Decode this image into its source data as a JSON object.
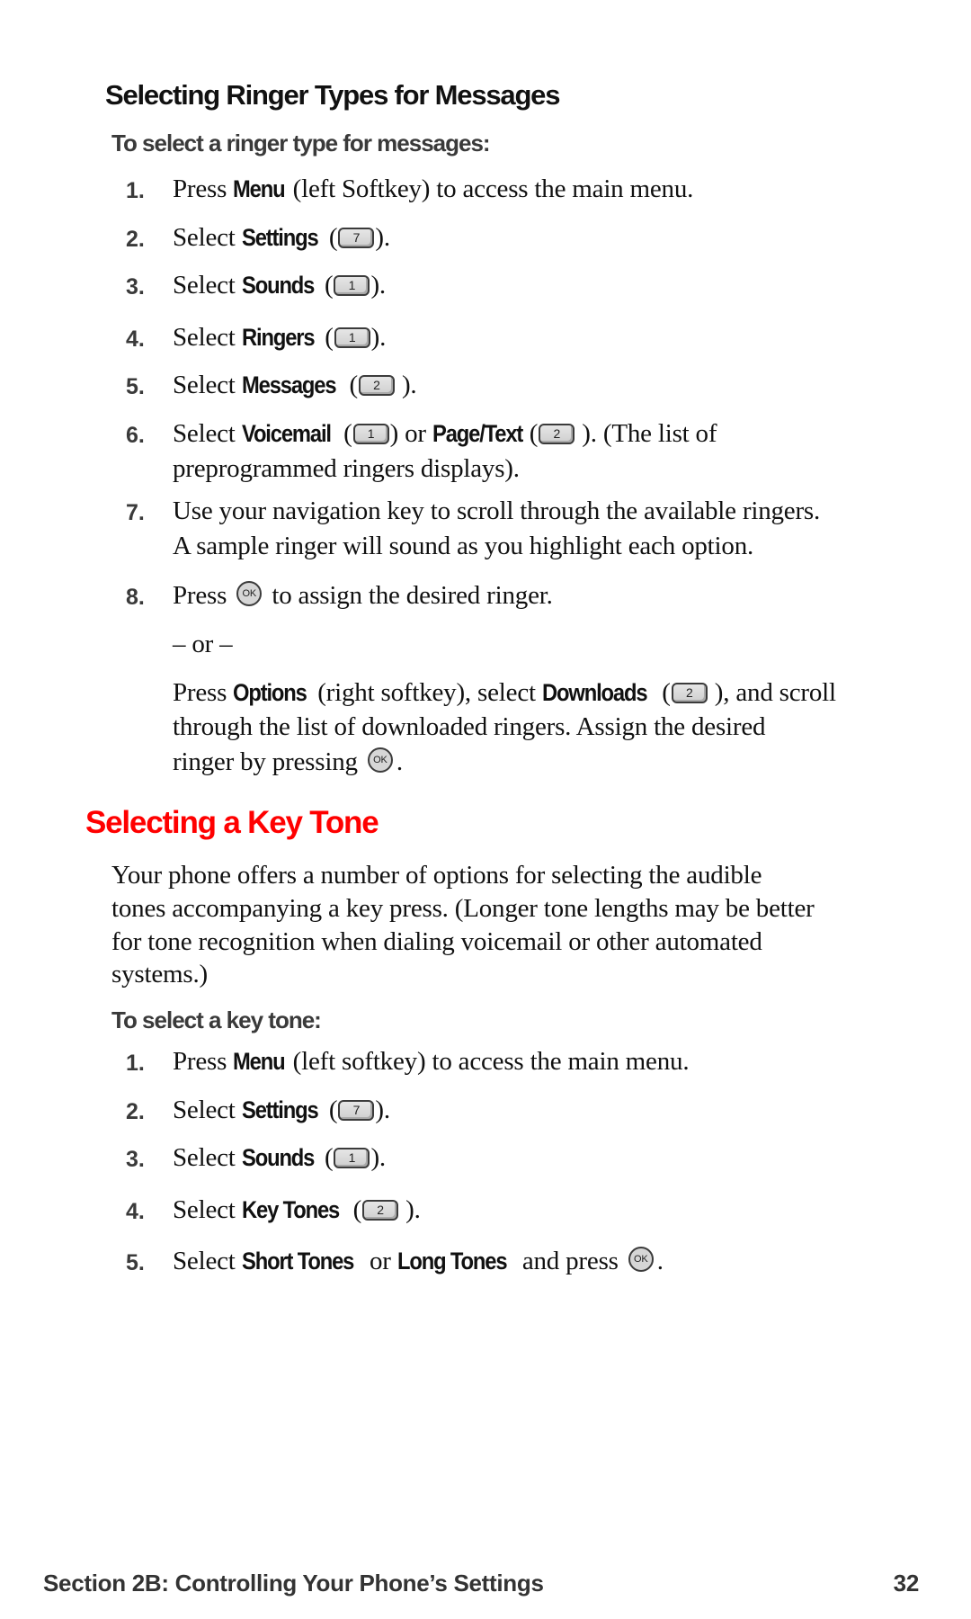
{
  "section1": {
    "heading": "Selecting Ringer Types for Messages",
    "subheading": "To select a ringer type for messages:",
    "steps": [
      {
        "num": "1.",
        "pre": "Press ",
        "bold": "Menu",
        "post": " (left Softkey) to access the main menu."
      },
      {
        "num": "2.",
        "pre": "Select ",
        "bold": "Settings",
        "open": " (",
        "key": "7",
        "post": ")."
      },
      {
        "num": "3.",
        "pre": "Select ",
        "bold": "Sounds",
        "open": " (",
        "key": "1",
        "post": ")."
      },
      {
        "num": "4.",
        "pre": "Select ",
        "bold": "Ringers",
        "open": " (",
        "key": "1",
        "post": ")."
      },
      {
        "num": "5.",
        "pre": "Select ",
        "bold": "Messages",
        "open": " (",
        "key": "2",
        "post": " )."
      },
      {
        "num": "6.",
        "pre": "Select ",
        "bold": "Voicemail",
        "open": " (",
        "key": "1",
        "mid": ") or ",
        "bold2": "Page/Text",
        "open2": "(",
        "key2": "2",
        "post": " ). (The list of",
        "cont": "preprogrammed ringers displays)."
      },
      {
        "num": "7.",
        "text": "Use your navigation key to scroll through the available ringers.",
        "cont": "A sample ringer will sound as you highlight each option."
      },
      {
        "num": "8.",
        "pre": "Press ",
        "ok": "OK",
        "post": " to assign the desired ringer."
      }
    ],
    "or_text": "– or –",
    "alt": {
      "pre": "Press ",
      "bold": "Options",
      "mid": " (right softkey), select ",
      "bold2": "Downloads",
      "open": " (",
      "key": "2",
      "post": " ), and scroll",
      "line2": "through the list of downloaded ringers. Assign the desired",
      "line3_pre": "ringer by pressing ",
      "ok": "OK",
      "line3_post": "."
    }
  },
  "section2": {
    "heading": "Selecting a Key Tone",
    "heading_color": "#ff0000",
    "paragraph": [
      "Your phone offers a number of options for selecting the audible",
      "tones accompanying a key press. (Longer tone lengths may be better",
      "for tone recognition when dialing voicemail or other automated",
      "systems.)"
    ],
    "subheading": "To select a key tone:",
    "steps": [
      {
        "num": "1.",
        "pre": "Press ",
        "bold": "Menu",
        "post": " (left softkey) to access the main menu."
      },
      {
        "num": "2.",
        "pre": "Select ",
        "bold": "Settings",
        "open": " (",
        "key": "7",
        "post": ")."
      },
      {
        "num": "3.",
        "pre": "Select ",
        "bold": "Sounds",
        "open": " (",
        "key": "1",
        "post": ")."
      },
      {
        "num": "4.",
        "pre": "Select ",
        "bold": "Key Tones",
        "open": " (",
        "key": "2",
        "post": " )."
      },
      {
        "num": "5.",
        "pre": "Select ",
        "bold": "Short Tones",
        "mid": " or ",
        "bold2": "Long Tones",
        "post2": " and press ",
        "ok": "OK",
        "post": "."
      }
    ]
  },
  "footer": {
    "section": "Section 2B: Controlling Your Phone’s Settings",
    "page": "32"
  }
}
